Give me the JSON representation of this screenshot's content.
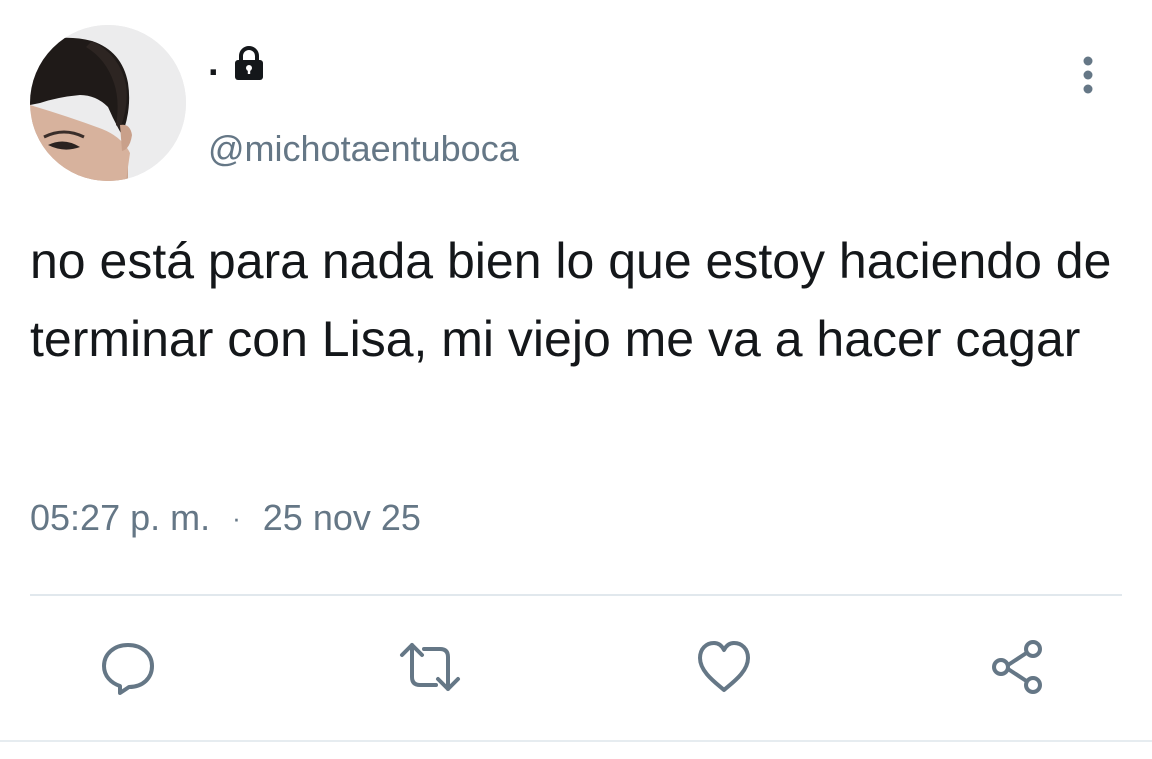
{
  "user": {
    "display_name": ".",
    "handle": "@michotaentuboca",
    "protected": true,
    "lock_icon": "lock-icon"
  },
  "tweet": {
    "text": "no está para nada bien lo que estoy haciendo de terminar con Lisa, mi viejo me va a hacer cagar",
    "time": "05:27 p. m.",
    "separator": "·",
    "date": "25 nov 25"
  },
  "actions": [
    {
      "name": "reply",
      "icon": "reply-icon"
    },
    {
      "name": "retweet",
      "icon": "retweet-icon"
    },
    {
      "name": "like",
      "icon": "heart-icon"
    },
    {
      "name": "share",
      "icon": "share-icon"
    }
  ],
  "colors": {
    "text": "#14171a",
    "secondary": "#657786",
    "divider": "#e1e8ed"
  }
}
